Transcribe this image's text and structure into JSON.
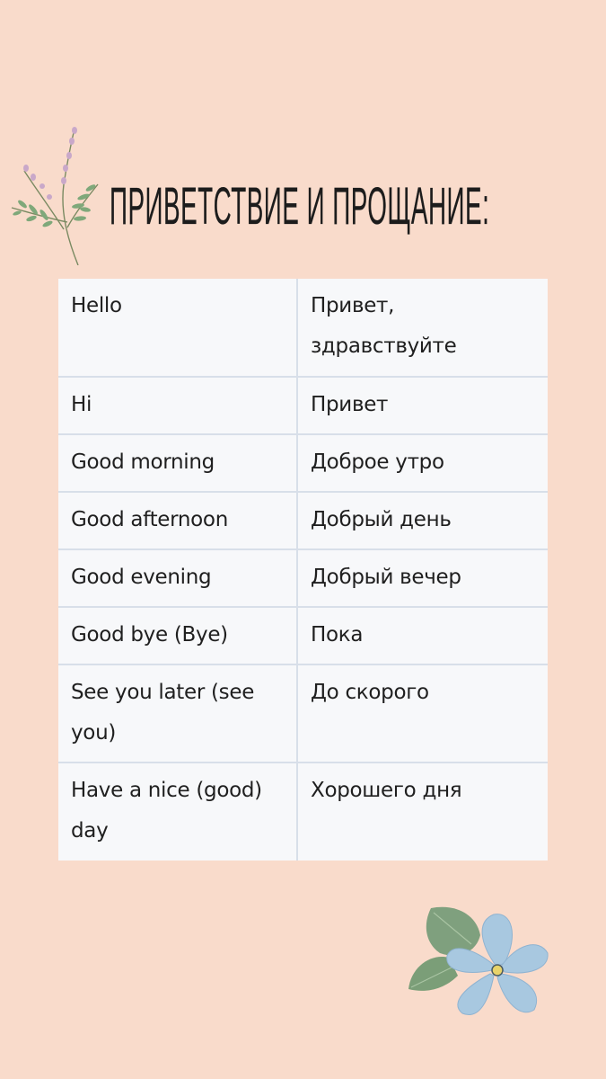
{
  "title": "ПРИВЕТСТВИЕ И ПРОЩАНИЕ:",
  "decorations": {
    "top_left": "lavender-sprig-icon",
    "bottom_right": "blue-flower-icon"
  },
  "colors": {
    "background": "#f9dbcb",
    "table_background": "#f7f8fa",
    "table_border": "#d8dfe9",
    "text": "#1f1f1f"
  },
  "table": {
    "rows": [
      {
        "en": "Hello",
        "ru": "Привет, здравствуйте"
      },
      {
        "en": "Hi",
        "ru": "Привет"
      },
      {
        "en": "Good morning",
        "ru": "Доброе утро"
      },
      {
        "en": "Good afternoon",
        "ru": "Добрый день"
      },
      {
        "en": "Good evening",
        "ru": "Добрый вечер"
      },
      {
        "en": "Good bye (Bye)",
        "ru": "Пока"
      },
      {
        "en": "See you later (see you)",
        "ru": "До скорого"
      },
      {
        "en": "Have a nice (good) day",
        "ru": "Хорошего дня"
      }
    ]
  }
}
